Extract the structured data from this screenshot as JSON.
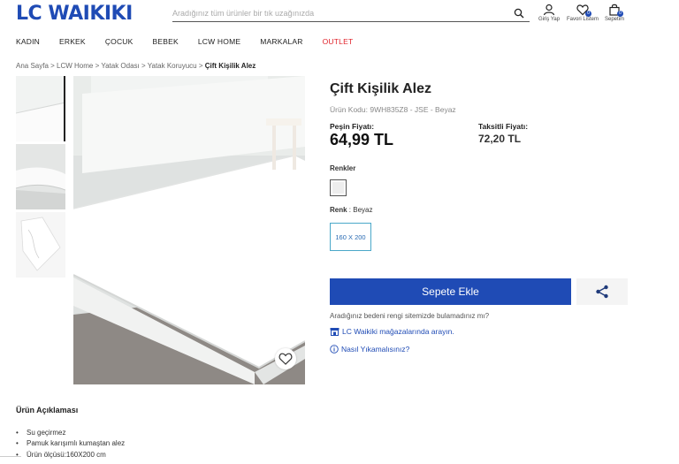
{
  "brand": {
    "logo_text": "LC WAIKIKI",
    "color": "#1f4bb5"
  },
  "search": {
    "placeholder": "Aradığınız tüm ürünler bir tık uzağınızda",
    "icon": "search-icon"
  },
  "header_icons": [
    {
      "name": "user-icon",
      "label": "Giriş Yap"
    },
    {
      "name": "heart-icon",
      "label": "Favori Listem",
      "badge": "0"
    },
    {
      "name": "bag-icon",
      "label": "Sepetim",
      "badge": "0"
    }
  ],
  "nav": [
    "KADIN",
    "ERKEK",
    "ÇOCUK",
    "BEBEK",
    "LCW HOME",
    "MARKALAR",
    "OUTLET"
  ],
  "breadcrumb": {
    "trail": "Ana Sayfa > LCW Home > Yatak Odası > Yatak Koruyucu > ",
    "current": "Çift Kişilik Alez"
  },
  "product": {
    "title": "Çift Kişilik Alez",
    "code": "Ürün Kodu: 9WH835Z8 - JSE - Beyaz",
    "cash_price_label": "Peşin Fiyatı:",
    "cash_price": "64,99 TL",
    "installment_label": "Taksitli Fiyatı:",
    "installment_price": "72,20 TL",
    "colors_label": "Renkler",
    "color_label": "Renk",
    "color_value": ": Beyaz",
    "size": "160 X 200",
    "add_to_cart": "Sepete Ekle",
    "help_text": "Aradığınız bedeni rengi sitemizde bulamadınız mı?",
    "store_link": "LC Waikiki mağazalarında arayın.",
    "wash_link": "Nasıl Yıkamalısınız?"
  },
  "description": {
    "title": "Ürün Açıklaması",
    "items": [
      "Su geçirmez",
      "Pamuk karışımlı kumaştan alez",
      "Ürün ölçüsü:160X200 cm"
    ]
  },
  "colors": {
    "accent": "#1f4bb5",
    "outlet": "#e0232b",
    "size_border": "#4aa8c9"
  }
}
